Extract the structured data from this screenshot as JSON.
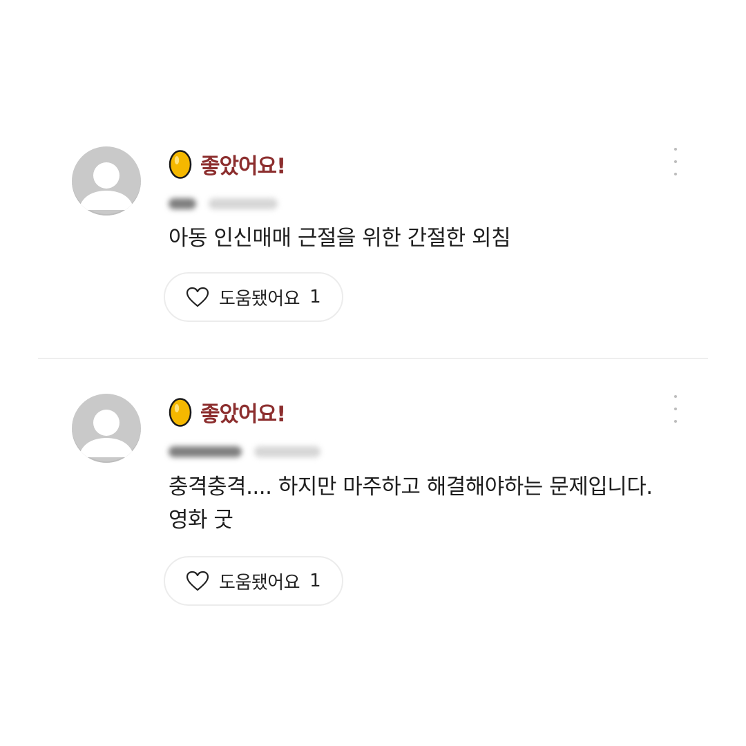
{
  "reviews": [
    {
      "rating_label": "좋았어요!",
      "comment_lines": [
        "아동 인신매매 근절을 위한 간절한 외침"
      ],
      "helpful_label": "도움됐어요",
      "helpful_count": "1"
    },
    {
      "rating_label": "좋았어요!",
      "comment_lines": [
        "충격충격.... 하지만 마주하고 해결해야하는 문제입니다.",
        "영화 굿"
      ],
      "helpful_label": "도움됐어요",
      "helpful_count": "1"
    }
  ],
  "icons": {
    "rating": "golden-egg-icon",
    "helpful": "heart-outline-icon",
    "more": "more-vertical-icon",
    "avatar": "default-user-avatar"
  },
  "colors": {
    "rating_text": "#8c2e2e",
    "egg_fill": "#f5b800",
    "avatar_bg": "#c9c9c9"
  }
}
